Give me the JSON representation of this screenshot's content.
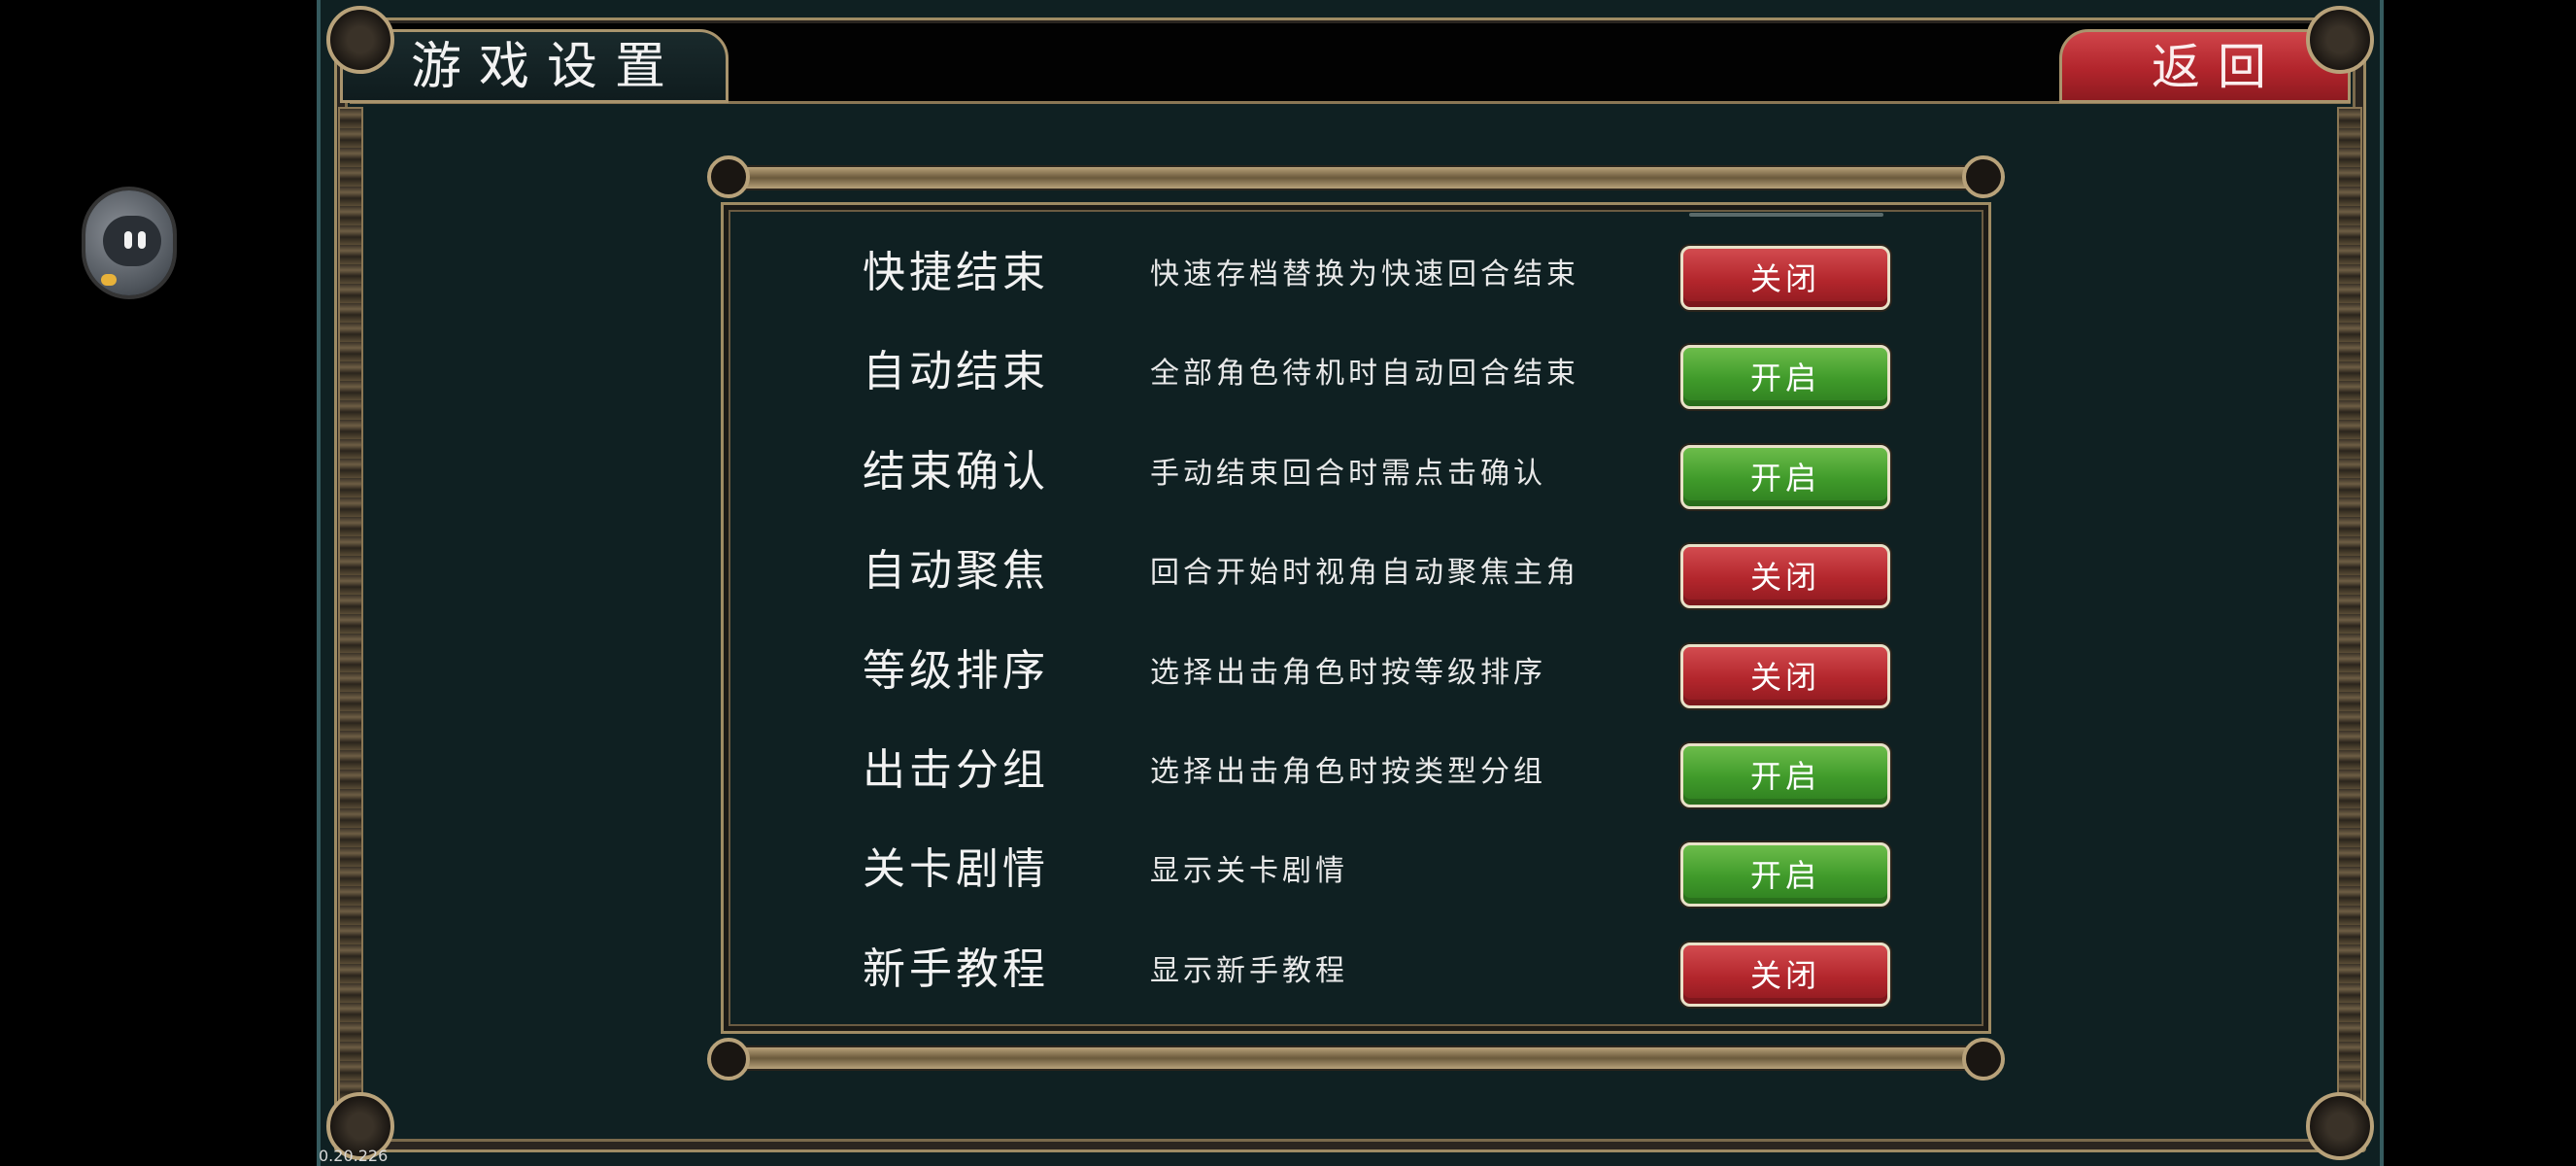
{
  "header": {
    "title": "游戏设置",
    "back_label": "返回"
  },
  "settings": [
    {
      "name": "快捷结束",
      "description": "快速存档替换为快速回合结束",
      "state": "off",
      "toggle_label": "关闭"
    },
    {
      "name": "自动结束",
      "description": "全部角色待机时自动回合结束",
      "state": "on",
      "toggle_label": "开启"
    },
    {
      "name": "结束确认",
      "description": "手动结束回合时需点击确认",
      "state": "on",
      "toggle_label": "开启"
    },
    {
      "name": "自动聚焦",
      "description": "回合开始时视角自动聚焦主角",
      "state": "off",
      "toggle_label": "关闭"
    },
    {
      "name": "等级排序",
      "description": "选择出击角色时按等级排序",
      "state": "off",
      "toggle_label": "关闭"
    },
    {
      "name": "出击分组",
      "description": "选择出击角色时按类型分组",
      "state": "on",
      "toggle_label": "开启"
    },
    {
      "name": "关卡剧情",
      "description": "显示关卡剧情",
      "state": "on",
      "toggle_label": "开启"
    },
    {
      "name": "新手教程",
      "description": "显示新手教程",
      "state": "off",
      "toggle_label": "关闭"
    }
  ],
  "colors": {
    "on": "#3f9a2a",
    "off": "#b3262c",
    "panel_bg": "#0f2022",
    "frame_gold": "#b8a27a"
  },
  "icons": {
    "floating_assistant": "robot-face-icon"
  },
  "version_text": "0.20.226"
}
